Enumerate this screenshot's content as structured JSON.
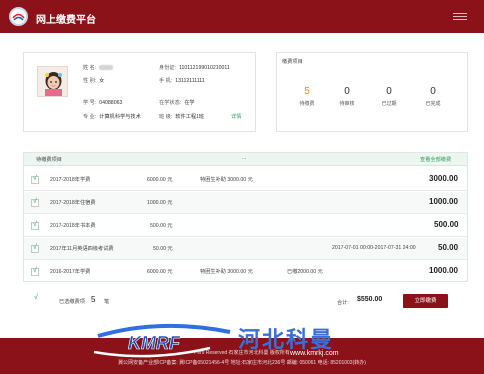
{
  "header": {
    "title": "网上缴费平台"
  },
  "user": {
    "name_label": "姓 名:",
    "id_label": "身份证:",
    "id_value": "110112199010210011",
    "gender_label": "性 别:",
    "gender_value": "女",
    "phone_label": "手 机:",
    "phone_value": "13112111111",
    "student_no_label": "学 号:",
    "student_no_value": "04088063",
    "status_label": "在学状态:",
    "status_value": "在学",
    "major_label": "专 业:",
    "major_value": "计算机科学与技术",
    "class_label": "班 级:",
    "class_value": "软件工程1班",
    "detail_link": "详情"
  },
  "fee_summary": {
    "title": "缴费项目",
    "stats": [
      {
        "value": "5",
        "label": "待缴费"
      },
      {
        "value": "0",
        "label": "待审核"
      },
      {
        "value": "0",
        "label": "已过期"
      },
      {
        "value": "0",
        "label": "已完成"
      }
    ]
  },
  "fee_list": {
    "header_title": "待缴费项目",
    "header_dots": "...",
    "view_all_link": "查看全部缴费",
    "items": [
      {
        "name": "2017-2018年学费",
        "standard": "6000.00 元",
        "note": "特困生补助 3000.00 元",
        "amount": "3000.00"
      },
      {
        "name": "2017-2018年住宿费",
        "standard": "1000.00 元",
        "note": "",
        "amount": "1000.00"
      },
      {
        "name": "2017-2018年书本费",
        "standard": "500.00 元",
        "note": "",
        "amount": "500.00"
      },
      {
        "name": "2017年11月英语四级考试费",
        "standard": "50.00 元",
        "note": "2017-07-01 00:00-2017-07-31 24:00",
        "amount": "50.00"
      },
      {
        "name": "2016-2017年学费",
        "standard": "6000.00 元",
        "note": "特困生补助 3000.00 元",
        "note2": "已缴2000.00 元",
        "amount": "1000.00"
      }
    ],
    "check_mark": "√"
  },
  "summary_bar": {
    "check_mark": "√",
    "selected_label": "已选缴费项",
    "selected_count": "5",
    "selected_unit": "笔",
    "total_label": "合计:",
    "total_value": "$550.00",
    "pay_button": "立即缴费"
  },
  "footer": {
    "line1": "Pers Reserved 石家庄市河北科曼 版权所有",
    "line2": "冀公网安备产业部ICP备案: 冀ICP备05021456-4号 地址:石家庄市河北236号 邮编: 050061 电话: 85201003(转办)"
  },
  "watermark": {
    "brand": "KMRF",
    "text": "河北科曼",
    "url": "www.kmrkj.com"
  },
  "colors": {
    "brand_red": "#8a1218",
    "accent_green": "#2a9d5c",
    "accent_orange": "#e8871e"
  }
}
